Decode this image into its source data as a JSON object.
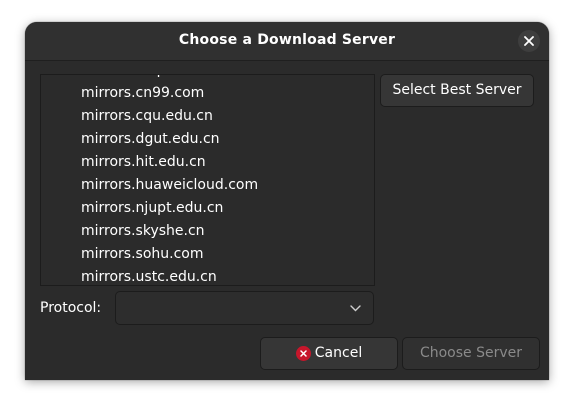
{
  "dialog": {
    "title": "Choose a Download Server"
  },
  "servers": [
    "mirrors.cn99.com",
    "mirrors.cqu.edu.cn",
    "mirrors.dgut.edu.cn",
    "mirrors.hit.edu.cn",
    "mirrors.huaweicloud.com",
    "mirrors.njupt.edu.cn",
    "mirrors.skyshe.cn",
    "mirrors.sohu.com",
    "mirrors.ustc.edu.cn"
  ],
  "buttons": {
    "select_best": "Select Best Server",
    "cancel": "Cancel",
    "choose": "Choose Server"
  },
  "protocol": {
    "label": "Protocol:",
    "value": ""
  },
  "colors": {
    "dialog_bg": "#2b2b2b",
    "cancel_icon": "#c7162b",
    "disabled_text": "#8a8a8a"
  }
}
